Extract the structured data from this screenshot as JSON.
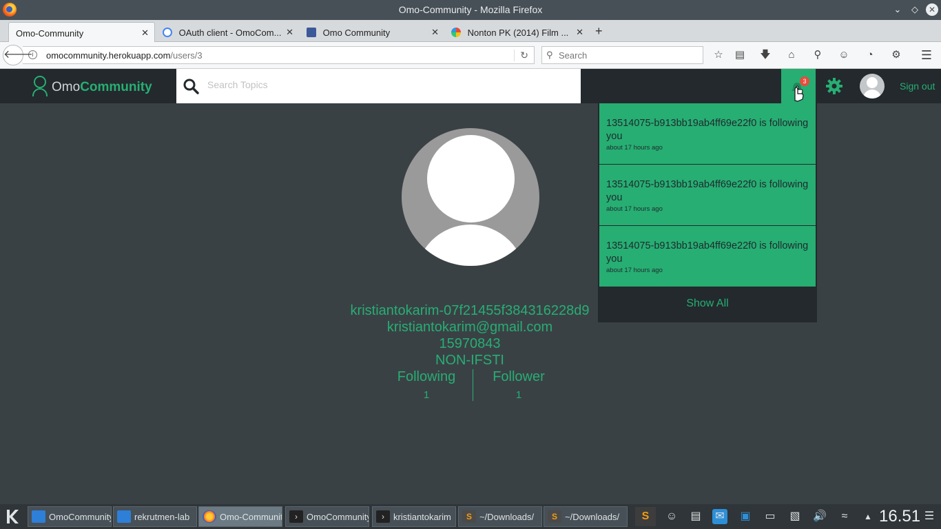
{
  "window": {
    "title": "Omo-Community - Mozilla Firefox"
  },
  "tabs": [
    {
      "label": "Omo-Community",
      "active": true
    },
    {
      "label": "OAuth client - OmoCom..."
    },
    {
      "label": "Omo Community"
    },
    {
      "label": "Nonton PK (2014) Film ..."
    }
  ],
  "nav": {
    "url_host": "omocommunity.herokuapp.com",
    "url_path": "/users/3",
    "search_placeholder": "Search"
  },
  "site": {
    "brand_light": "Omo",
    "brand_bold": "Community",
    "search_placeholder": "Search Topics",
    "notification_count": "3",
    "signout_label": "Sign out",
    "accent_color": "#27ae73",
    "header_color": "#23292d",
    "page_bg": "#3a4145"
  },
  "profile": {
    "username": "kristiantokarim-07f21455f384316228d9",
    "email": "kristiantokarim@gmail.com",
    "student_id": "15970843",
    "department": "NON-IFSTI",
    "following_label": "Following",
    "following_count": "1",
    "follower_label": "Follower",
    "follower_count": "1"
  },
  "notifications": {
    "items": [
      {
        "text": "13514075-b913bb19ab4ff69e22f0 is following you",
        "time": "about 17 hours ago"
      },
      {
        "text": "13514075-b913bb19ab4ff69e22f0 is following you",
        "time": "about 17 hours ago"
      },
      {
        "text": "13514075-b913bb19ab4ff69e22f0 is following you",
        "time": "about 17 hours ago"
      }
    ],
    "show_all_label": "Show All"
  },
  "taskbar": {
    "tasks": [
      {
        "label": "OmoCommunity",
        "icon": "mail-icon"
      },
      {
        "label": "rekrutmen-lab",
        "icon": "mail-icon"
      },
      {
        "label": "Omo-Community",
        "icon": "firefox-icon",
        "active": true
      },
      {
        "label": "OmoCommunity",
        "icon": "terminal-icon"
      },
      {
        "label": "kristiantokarim",
        "icon": "terminal-icon"
      },
      {
        "label": "~/Downloads/",
        "icon": "sublime-icon"
      },
      {
        "label": "~/Downloads/",
        "icon": "sublime-icon"
      }
    ],
    "clock": "16.51"
  }
}
